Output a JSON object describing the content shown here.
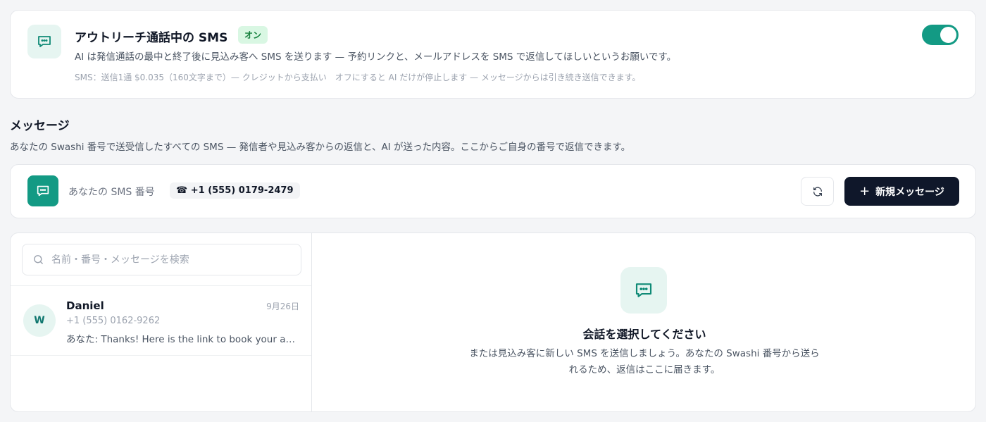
{
  "outreach": {
    "icon": "chat-bubble-icon",
    "title": "アウトリーチ通話中の SMS",
    "badge": "オン",
    "description": "AI は発信通話の最中と終了後に見込み客へ SMS を送ります — 予約リンクと、メールアドレスを SMS で返信してほしいというお願いです。",
    "note": "SMS：送信1通 $0.035（160文字まで）— クレジットから支払い　オフにすると AI だけが停止します — メッセージからは引き続き送信できます。",
    "toggle_on": true
  },
  "messages": {
    "title": "メッセージ",
    "description": "あなたの Swashi 番号で送受信したすべての SMS — 発信者や見込み客からの返信と、AI が送った内容。ここからご自身の番号で返信できます。"
  },
  "number_bar": {
    "label": "あなたの SMS 番号",
    "phone_icon": "☎",
    "number": "+1 (555) 0179-2479",
    "new_message_label": "新規メッセージ"
  },
  "search": {
    "placeholder": "名前・番号・メッセージを検索",
    "value": ""
  },
  "conversations": [
    {
      "avatar": "W",
      "name": "Daniel",
      "date": "9月26日",
      "phone": "+1 (555) 0162-9262",
      "preview": "あなた: Thanks! Here is the link to book your appointment"
    }
  ],
  "empty_state": {
    "title": "会話を選択してください",
    "description": "または見込み客に新しい SMS を送信しましょう。あなたの Swashi 番号から送られるため、返信はここに届きます。"
  },
  "colors": {
    "accent": "#139a84",
    "accent_soft": "#e6f5f1",
    "primary_button": "#0f172a",
    "badge_bg": "#d9f7e3",
    "badge_text": "#15803d"
  }
}
